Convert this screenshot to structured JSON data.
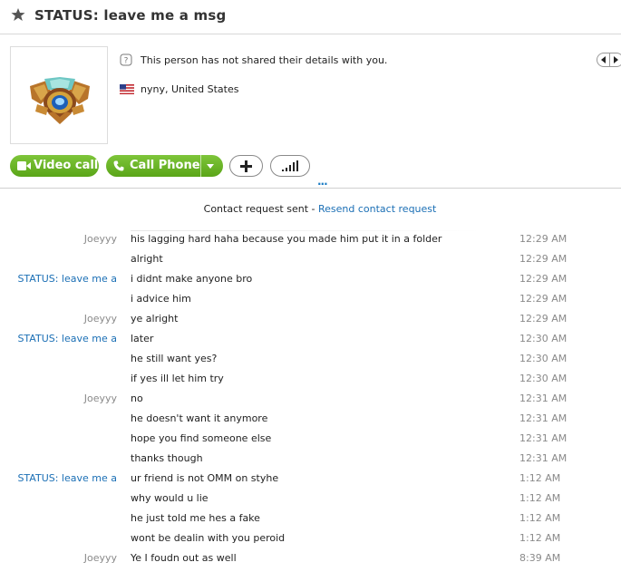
{
  "header": {
    "title": "STATUS:  leave me a msg",
    "icon": "star-icon"
  },
  "profile": {
    "details_text": "This person has not shared their details with you.",
    "location_text": "nyny, United States",
    "flag": "us-flag-icon"
  },
  "actions": {
    "video_call_label": "Video call",
    "call_phone_label": "Call Phone",
    "accent_color": "#6bb521"
  },
  "request": {
    "sent_text": "Contact request sent - ",
    "resend_label": "Resend contact request",
    "link_color": "#1b6fb5"
  },
  "messages": [
    {
      "sender": "Joeyyy",
      "self": false,
      "text": "his lagging hard haha because you made him put it in a folder",
      "time": "12:29 AM"
    },
    {
      "sender": "",
      "self": false,
      "text": "alright",
      "time": "12:29 AM"
    },
    {
      "sender": "STATUS:  leave me a",
      "self": true,
      "text": "i didnt make anyone bro",
      "time": "12:29 AM"
    },
    {
      "sender": "",
      "self": true,
      "text": "i advice him",
      "time": "12:29 AM"
    },
    {
      "sender": "Joeyyy",
      "self": false,
      "text": "ye alright",
      "time": "12:29 AM"
    },
    {
      "sender": "STATUS:  leave me a",
      "self": true,
      "text": "later",
      "time": "12:30 AM"
    },
    {
      "sender": "",
      "self": true,
      "text": "he still want yes?",
      "time": "12:30 AM"
    },
    {
      "sender": "",
      "self": true,
      "text": "if yes ill let him try",
      "time": "12:30 AM"
    },
    {
      "sender": "Joeyyy",
      "self": false,
      "text": "no",
      "time": "12:31 AM"
    },
    {
      "sender": "",
      "self": false,
      "text": "he doesn't want it anymore",
      "time": "12:31 AM"
    },
    {
      "sender": "",
      "self": false,
      "text": "hope you find someone else",
      "time": "12:31 AM"
    },
    {
      "sender": "",
      "self": false,
      "text": "thanks though",
      "time": "12:31 AM"
    },
    {
      "sender": "STATUS:  leave me a",
      "self": true,
      "text": "ur friend is not OMM on styhe",
      "time": "1:12 AM"
    },
    {
      "sender": "",
      "self": true,
      "text": "why would u lie",
      "time": "1:12 AM"
    },
    {
      "sender": "",
      "self": true,
      "text": "he just told me hes a fake",
      "time": "1:12 AM"
    },
    {
      "sender": "",
      "self": true,
      "text": "wont be dealin with you peroid",
      "time": "1:12 AM"
    },
    {
      "sender": "Joeyyy",
      "self": false,
      "text": "Ye I foudn out as well",
      "time": "8:39 AM"
    }
  ]
}
